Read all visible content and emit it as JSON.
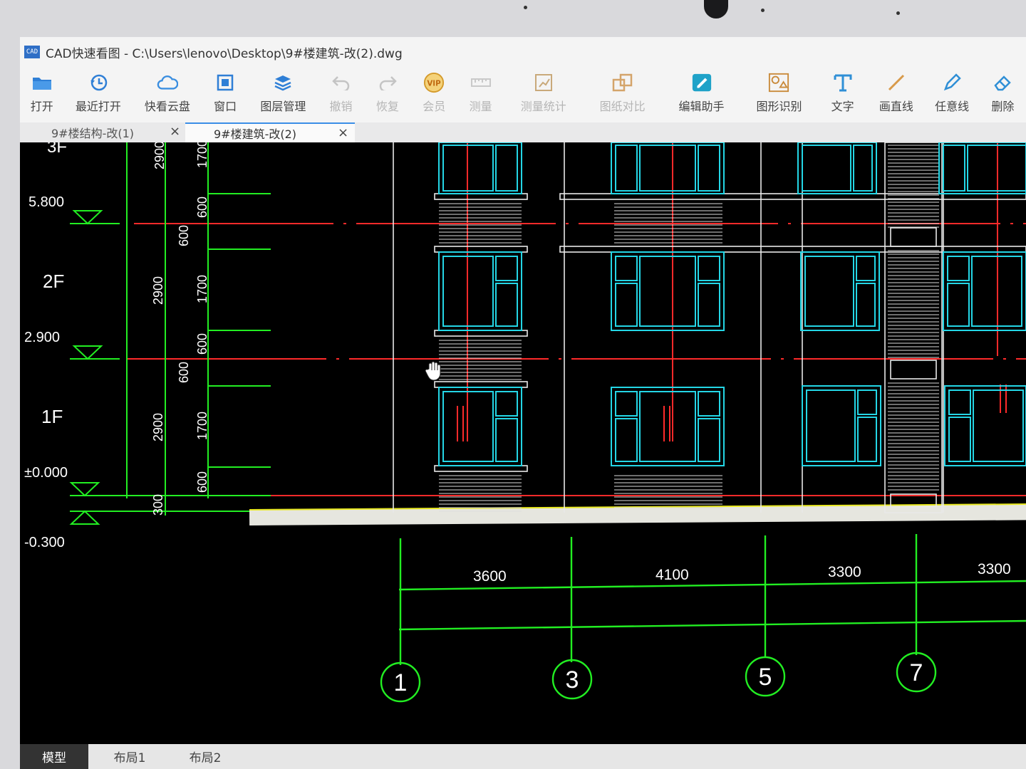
{
  "window": {
    "app_icon_text": "CAD",
    "title": "CAD快速看图 - C:\\Users\\lenovo\\Desktop\\9#楼建筑-改(2).dwg"
  },
  "toolbar": {
    "open": "打开",
    "recent": "最近打开",
    "cloud": "快看云盘",
    "window": "窗口",
    "layers": "图层管理",
    "undo": "撤销",
    "redo": "恢复",
    "vip": "会员",
    "vip_badge": "VIP",
    "measure": "测量",
    "measure_stats": "测量统计",
    "compare": "图纸对比",
    "edit_assistant": "编辑助手",
    "shape_recognition": "图形识别",
    "text": "文字",
    "line": "画直线",
    "freeline": "任意线",
    "delete": "删除"
  },
  "tabs": {
    "tab1": "9#楼结构-改(1)",
    "tab2": "9#楼建筑-改(2)",
    "close": "×"
  },
  "drawing": {
    "floor_3f": "3F",
    "level_580": "5.800",
    "floor_2f": "2F",
    "level_290": "2.900",
    "floor_1f": "1F",
    "level_000": "±0.000",
    "level_m030": "-0.300",
    "dim_2900": "2900",
    "dim_1700": "1700",
    "dim_600": "600",
    "dim_300": "300",
    "span_3600": "3600",
    "span_4100": "4100",
    "span_3300a": "3300",
    "span_3300b": "3300",
    "axis_1": "1",
    "axis_3": "3",
    "axis_5": "5",
    "axis_7": "7"
  },
  "bottom_tabs": {
    "model": "模型",
    "layout1": "布局1",
    "layout2": "布局2"
  },
  "colors": {
    "green": "#22ee22",
    "red": "#ff2a2a",
    "cyan": "#24d6e6",
    "white": "#e8e8e8"
  }
}
